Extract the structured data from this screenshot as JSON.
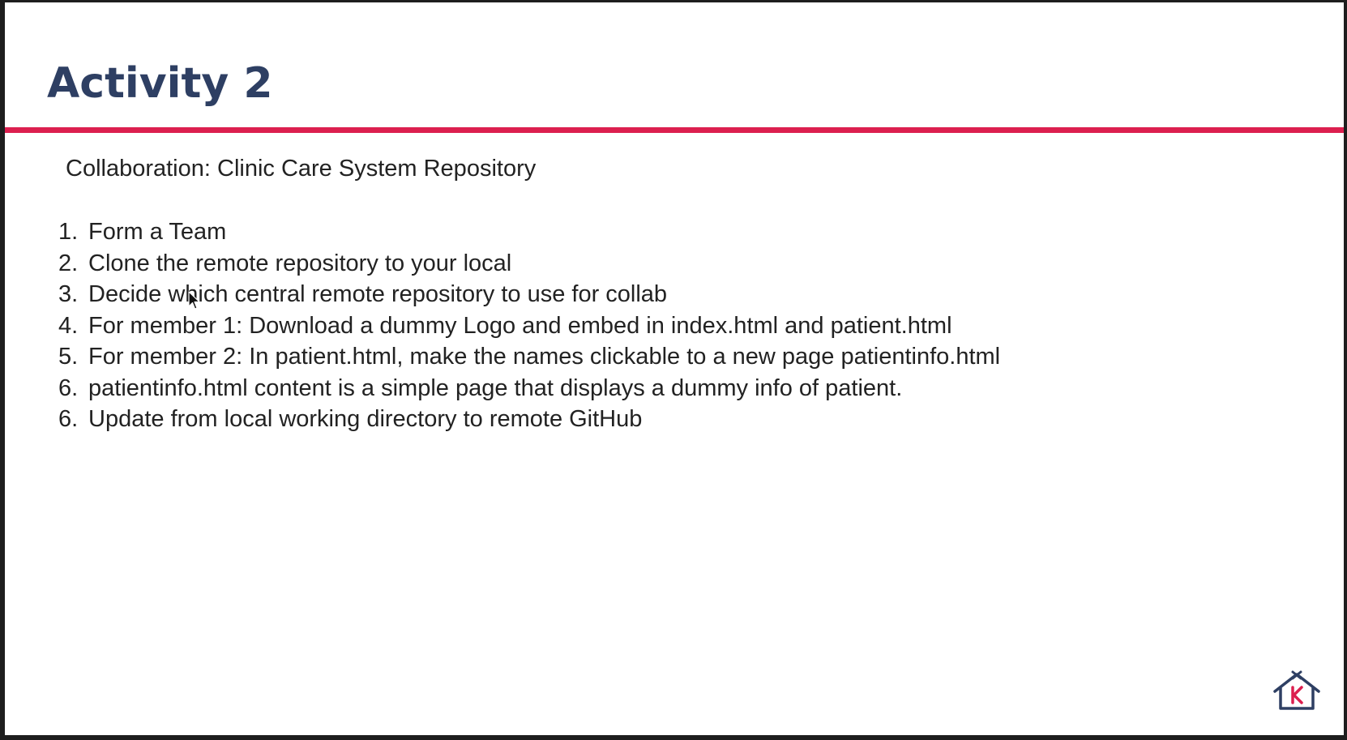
{
  "slide": {
    "title": "Activity 2",
    "subtitle": "Collaboration: Clinic Care System Repository",
    "steps": [
      {
        "num": "1.",
        "text": "Form a Team"
      },
      {
        "num": "2.",
        "text": "Clone the remote repository to your local"
      },
      {
        "num": "3.",
        "text": "Decide which central remote repository to use for collab"
      },
      {
        "num": "4.",
        "text": "For member 1: Download a dummy Logo and embed in index.html and patient.html"
      },
      {
        "num": "5.",
        "text": "For member 2: In patient.html, make the names clickable to a new page patientinfo.html"
      },
      {
        "num": "6.",
        "text": "patientinfo.html content is a simple page that displays a dummy info of patient."
      },
      {
        "num": "6.",
        "text": "Update from local working directory to remote GitHub"
      }
    ]
  },
  "icons": {
    "cursor": "mouse-pointer-icon",
    "logo": "house-k-logo-icon"
  },
  "colors": {
    "title": "#2e3f63",
    "accent_rule": "#dc1f4f",
    "body_text": "#222222",
    "logo_outline": "#2e3f63",
    "logo_letter": "#dc1f4f",
    "frame": "#1e1e1e"
  }
}
